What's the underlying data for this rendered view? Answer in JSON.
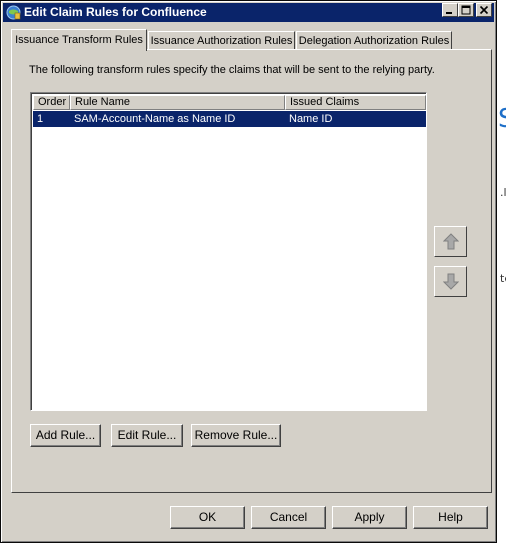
{
  "window": {
    "title": "Edit Claim Rules for Confluence"
  },
  "tabs": [
    {
      "label": "Issuance Transform Rules",
      "active": true
    },
    {
      "label": "Issuance Authorization Rules",
      "active": false
    },
    {
      "label": "Delegation Authorization Rules",
      "active": false
    }
  ],
  "panel": {
    "description": "The following transform rules specify the claims that will be sent to the relying party."
  },
  "rules_table": {
    "columns": [
      "Order",
      "Rule Name",
      "Issued Claims"
    ],
    "rows": [
      {
        "order": "1",
        "rule_name": "SAM-Account-Name as Name ID",
        "issued_claims": "Name ID",
        "selected": true
      }
    ]
  },
  "rule_buttons": {
    "add": "Add Rule...",
    "edit": "Edit Rule...",
    "remove": "Remove Rule..."
  },
  "dialog_buttons": {
    "ok": "OK",
    "cancel": "Cancel",
    "apply": "Apply",
    "help": "Help"
  },
  "background": {
    "fragment_1": "S",
    "fragment_2": ".l",
    "fragment_3": "te"
  },
  "colors": {
    "title_bar": "#0a246a",
    "face": "#d4d0c8",
    "selection": "#0a246a"
  }
}
